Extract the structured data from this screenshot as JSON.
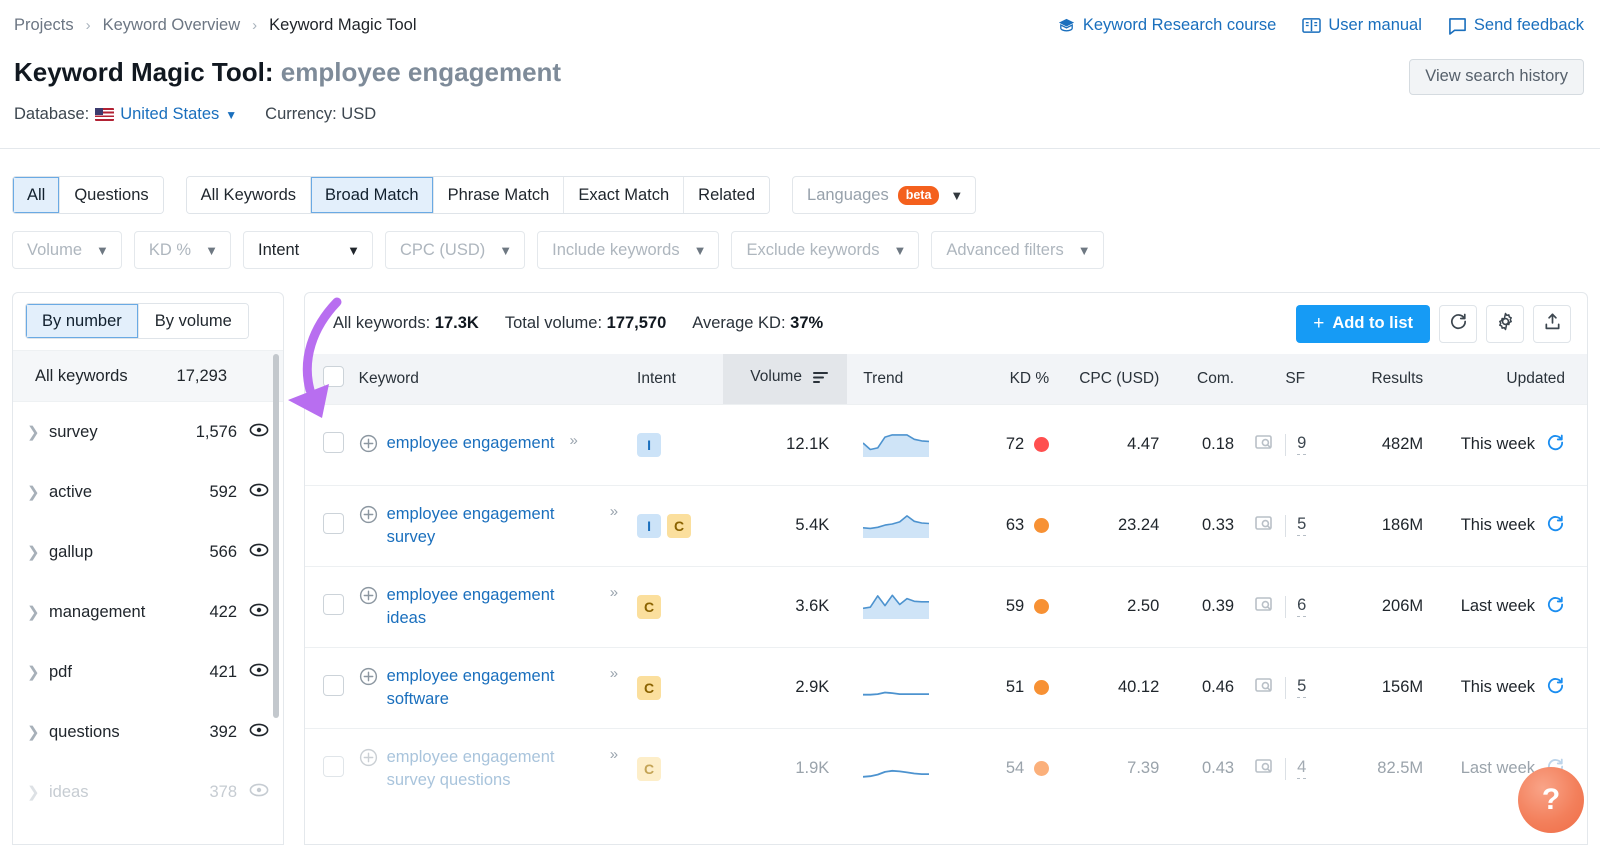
{
  "breadcrumb": {
    "items": [
      "Projects",
      "Keyword Overview",
      "Keyword Magic Tool"
    ],
    "separator": "›"
  },
  "header": {
    "links": [
      {
        "label": "Keyword Research course",
        "icon": "graduation-cap-icon"
      },
      {
        "label": "User manual",
        "icon": "book-icon"
      },
      {
        "label": "Send feedback",
        "icon": "speech-bubble-icon"
      }
    ],
    "title_prefix": "Keyword Magic Tool:",
    "title_query": "employee engagement",
    "view_history_label": "View search history",
    "database_label": "Database:",
    "database_value": "United States",
    "currency_label": "Currency: USD"
  },
  "match_tabs": {
    "primary": [
      {
        "label": "All",
        "selected": true
      },
      {
        "label": "Questions",
        "selected": false
      }
    ],
    "match": [
      {
        "label": "All Keywords",
        "selected": false
      },
      {
        "label": "Broad Match",
        "selected": true
      },
      {
        "label": "Phrase Match",
        "selected": false
      },
      {
        "label": "Exact Match",
        "selected": false
      },
      {
        "label": "Related",
        "selected": false
      }
    ],
    "languages": {
      "label": "Languages",
      "badge": "beta"
    }
  },
  "filters": [
    {
      "label": "Volume",
      "active": false
    },
    {
      "label": "KD %",
      "active": false
    },
    {
      "label": "Intent",
      "active": true
    },
    {
      "label": "CPC (USD)",
      "active": false
    },
    {
      "label": "Include keywords",
      "active": false
    },
    {
      "label": "Exclude keywords",
      "active": false
    },
    {
      "label": "Advanced filters",
      "active": false
    }
  ],
  "sidebar": {
    "toggle": [
      {
        "label": "By number",
        "selected": true
      },
      {
        "label": "By volume",
        "selected": false
      }
    ],
    "all_keywords_label": "All keywords",
    "all_keywords_count": "17,293",
    "groups": [
      {
        "label": "survey",
        "count": "1,576",
        "dim": false
      },
      {
        "label": "active",
        "count": "592",
        "dim": false
      },
      {
        "label": "gallup",
        "count": "566",
        "dim": false
      },
      {
        "label": "management",
        "count": "422",
        "dim": false
      },
      {
        "label": "pdf",
        "count": "421",
        "dim": false
      },
      {
        "label": "questions",
        "count": "392",
        "dim": false
      },
      {
        "label": "ideas",
        "count": "378",
        "dim": true
      }
    ]
  },
  "summary": {
    "all_keywords_label": "All keywords:",
    "all_keywords_value": "17.3K",
    "total_volume_label": "Total volume:",
    "total_volume_value": "177,570",
    "average_kd_label": "Average KD:",
    "average_kd_value": "37%",
    "add_to_list_label": "Add to list",
    "plus": "+"
  },
  "table": {
    "columns": {
      "keyword": "Keyword",
      "intent": "Intent",
      "volume": "Volume",
      "trend": "Trend",
      "kd": "KD %",
      "cpc": "CPC (USD)",
      "com": "Com.",
      "sf": "SF",
      "results": "Results",
      "updated": "Updated"
    },
    "sorted_column": "Volume",
    "rows": [
      {
        "keyword": "employee engagement",
        "intent": [
          "I"
        ],
        "volume": "12.1K",
        "kd": "72",
        "kd_color": "#ff4f4f",
        "cpc": "4.47",
        "com": "0.18",
        "sf": "9",
        "results": "482M",
        "updated": "This week",
        "faded": false,
        "trend": [
          48,
          24,
          30,
          70,
          78,
          78,
          78,
          62,
          56,
          54
        ]
      },
      {
        "keyword": "employee engagement survey",
        "intent": [
          "I",
          "C"
        ],
        "volume": "5.4K",
        "kd": "63",
        "kd_color": "#f79134",
        "cpc": "23.24",
        "com": "0.33",
        "sf": "5",
        "results": "186M",
        "updated": "This week",
        "faded": false,
        "trend": [
          34,
          32,
          36,
          44,
          48,
          56,
          78,
          58,
          52,
          50
        ]
      },
      {
        "keyword": "employee engagement ideas",
        "intent": [
          "C"
        ],
        "volume": "3.6K",
        "kd": "59",
        "kd_color": "#f79134",
        "cpc": "2.50",
        "com": "0.39",
        "sf": "6",
        "results": "206M",
        "updated": "Last week",
        "faded": false,
        "trend": [
          36,
          40,
          82,
          46,
          84,
          50,
          72,
          62,
          60,
          60
        ]
      },
      {
        "keyword": "employee engagement software",
        "intent": [
          "C"
        ],
        "volume": "2.9K",
        "kd": "51",
        "kd_color": "#f79134",
        "cpc": "40.12",
        "com": "0.46",
        "sf": "5",
        "results": "156M",
        "updated": "This week",
        "faded": false,
        "trend": [
          16,
          16,
          18,
          24,
          22,
          18,
          18,
          18,
          18,
          18
        ]
      },
      {
        "keyword": "employee engagement survey questions",
        "intent": [
          "C"
        ],
        "volume": "1.9K",
        "kd": "54",
        "kd_color": "#fbb07b",
        "cpc": "7.39",
        "com": "0.43",
        "sf": "4",
        "results": "82.5M",
        "updated": "Last week",
        "faded": true,
        "trend": [
          12,
          14,
          20,
          30,
          34,
          32,
          28,
          24,
          22,
          22
        ]
      }
    ]
  },
  "help": {
    "label": "?"
  },
  "colors": {
    "accent_blue": "#169bf5",
    "link_blue": "#1a6fbd",
    "annotation_purple": "#b86ef0",
    "beta_orange": "#f4601d"
  }
}
